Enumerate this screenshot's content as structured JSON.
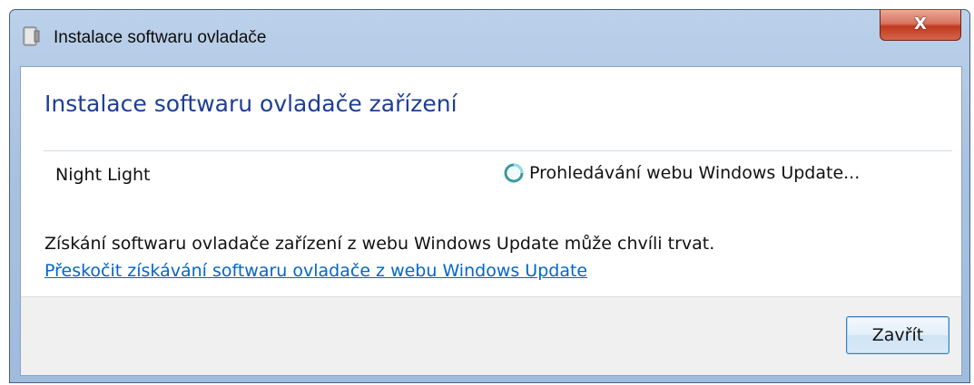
{
  "window": {
    "title": "Instalace softwaru ovladače",
    "close_glyph": "X",
    "app_icon": "driver-install-icon"
  },
  "content": {
    "heading": "Instalace softwaru ovladače zařízení",
    "device_name": "Night Light",
    "status_icon": "searching-spinner-icon",
    "status_text": "Prohledávání webu Windows Update...",
    "info_text": "Získání softwaru ovladače zařízení z webu Windows Update může chvíli trvat.",
    "skip_link": "Přeskočit získávání softwaru ovladače z webu Windows Update"
  },
  "footer": {
    "close_button": "Zavřít"
  },
  "colors": {
    "heading": "#1e3e95",
    "link": "#0066cc",
    "close_button_red": "#c0391f"
  }
}
